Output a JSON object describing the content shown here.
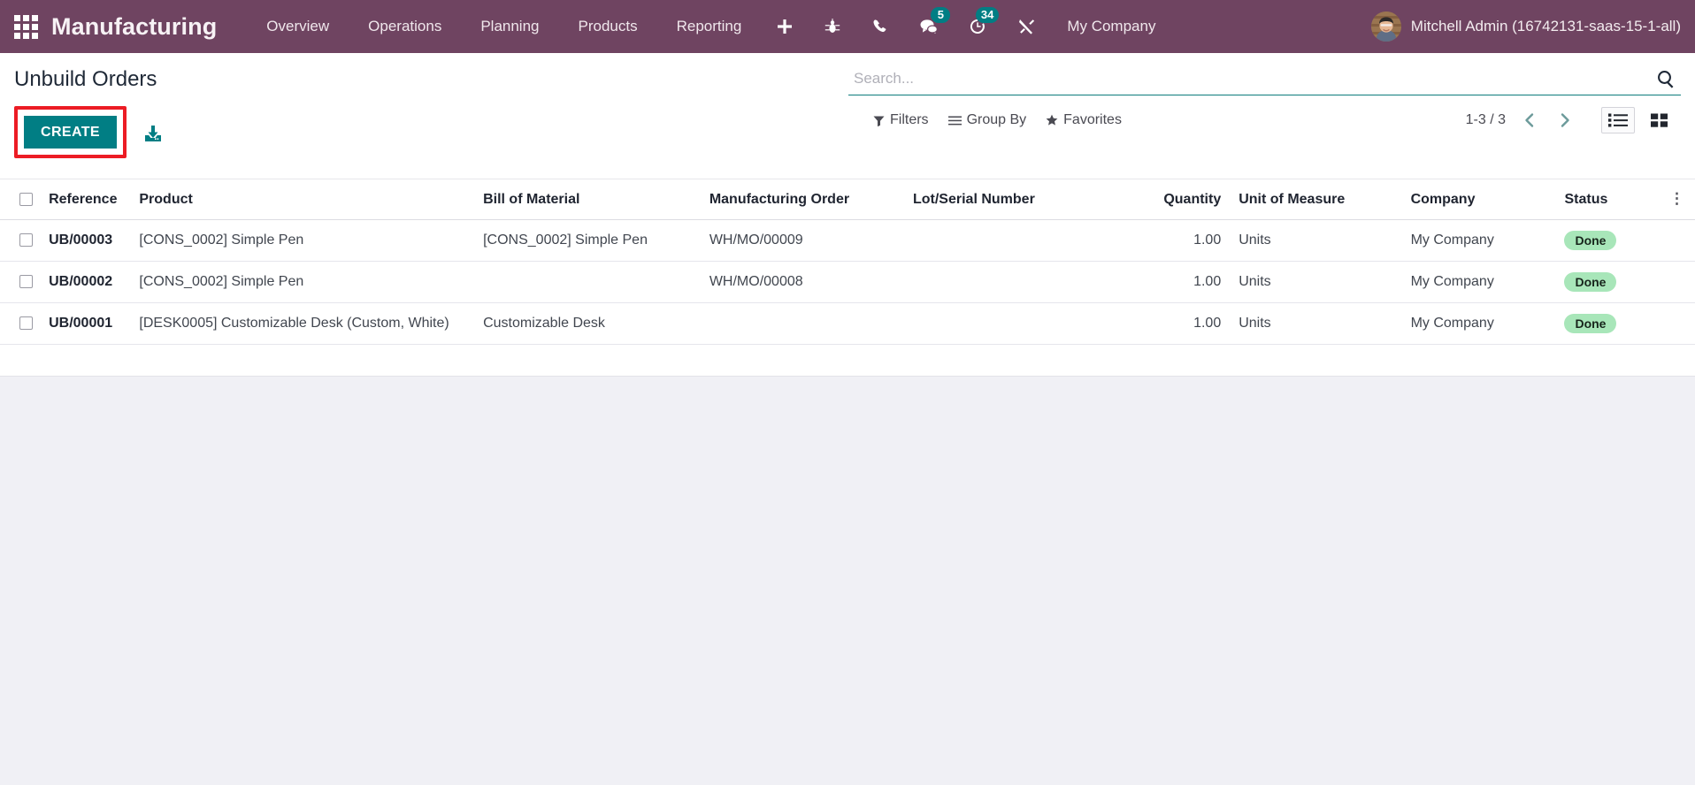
{
  "navbar": {
    "apps_icon": "apps-grid-icon",
    "brand": "Manufacturing",
    "menu": [
      {
        "label": "Overview"
      },
      {
        "label": "Operations"
      },
      {
        "label": "Planning"
      },
      {
        "label": "Products"
      },
      {
        "label": "Reporting"
      }
    ],
    "icons": [
      {
        "name": "plus-icon",
        "badge": null
      },
      {
        "name": "bug-icon",
        "badge": null
      },
      {
        "name": "phone-icon",
        "badge": null
      },
      {
        "name": "messages-icon",
        "badge": "5"
      },
      {
        "name": "activity-clock-icon",
        "badge": "34"
      },
      {
        "name": "tools-icon",
        "badge": null
      }
    ],
    "company": "My Company",
    "user_name": "Mitchell Admin (16742131-saas-15-1-all)",
    "accent_color": "#6f4461",
    "badge_color": "#017e84"
  },
  "control_panel": {
    "title": "Unbuild Orders",
    "create_label": "CREATE",
    "create_color": "#017e84",
    "highlight_color": "#ec1c24",
    "import_icon": "import-download-icon",
    "search": {
      "placeholder": "Search...",
      "value": "",
      "icon": "search-icon"
    },
    "filters": [
      {
        "label": "Filters",
        "icon": "filter-funnel-icon"
      },
      {
        "label": "Group By",
        "icon": "group-lines-icon"
      },
      {
        "label": "Favorites",
        "icon": "star-icon"
      }
    ],
    "pager": {
      "range": "1-3 / 3",
      "prev_icon": "chevron-left-icon",
      "next_icon": "chevron-right-icon"
    },
    "views": [
      {
        "name": "list-view",
        "icon": "list-icon",
        "active": true
      },
      {
        "name": "kanban-view",
        "icon": "kanban-grid-icon",
        "active": false
      }
    ]
  },
  "table": {
    "columns": [
      "Reference",
      "Product",
      "Bill of Material",
      "Manufacturing Order",
      "Lot/Serial Number",
      "Quantity",
      "Unit of Measure",
      "Company",
      "Status"
    ],
    "options_icon": "vertical-dots-icon",
    "rows": [
      {
        "reference": "UB/00003",
        "product": "[CONS_0002] Simple Pen",
        "bill_of_material": "[CONS_0002] Simple Pen",
        "manufacturing_order": "WH/MO/00009",
        "lot_serial_number": "",
        "quantity": "1.00",
        "unit_of_measure": "Units",
        "company": "My Company",
        "status": "Done"
      },
      {
        "reference": "UB/00002",
        "product": "[CONS_0002] Simple Pen",
        "bill_of_material": "",
        "manufacturing_order": "WH/MO/00008",
        "lot_serial_number": "",
        "quantity": "1.00",
        "unit_of_measure": "Units",
        "company": "My Company",
        "status": "Done"
      },
      {
        "reference": "UB/00001",
        "product": "[DESK0005] Customizable Desk (Custom, White)",
        "bill_of_material": "Customizable Desk",
        "manufacturing_order": "",
        "lot_serial_number": "",
        "quantity": "1.00",
        "unit_of_measure": "Units",
        "company": "My Company",
        "status": "Done"
      }
    ],
    "status_color": "#a8e6b9"
  }
}
